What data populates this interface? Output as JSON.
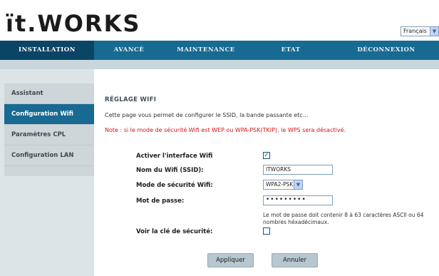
{
  "header": {
    "logo_text": "ït.WORKS",
    "language": {
      "selected": "Français"
    }
  },
  "nav": {
    "items": [
      {
        "label": "INSTALLATION",
        "active": true
      },
      {
        "label": "AVANCÉ",
        "active": false
      },
      {
        "label": "MAINTENANCE",
        "active": false
      },
      {
        "label": "ETAT",
        "active": false
      },
      {
        "label": "DÉCONNEXION",
        "active": false
      }
    ]
  },
  "sidebar": {
    "items": [
      {
        "label": "Assistant",
        "active": false
      },
      {
        "label": "Configuration Wifi",
        "active": true
      },
      {
        "label": "Paramètres CPL",
        "active": false
      },
      {
        "label": "Configuration LAN",
        "active": false
      }
    ]
  },
  "main": {
    "title": "RÉGLAGE WIFI",
    "description": "Cette page vous permet de configurer le SSID, la bande passante etc...",
    "note": "Note : si le mode de sécurité Wifi est WEP ou WPA-PSK(TKIP), le WPS sera désactivé.",
    "form": {
      "enable_label": "Activer l'interface Wifi",
      "enable_checked": true,
      "enable_checkmark": "✓",
      "ssid_label": "Nom du Wifi (SSID):",
      "ssid_value": "ITWORKS",
      "security_label": "Mode de sécurité Wifi:",
      "security_value": "WPA2-PSK",
      "password_label": "Mot de passe:",
      "password_value": "•••••••••",
      "password_hint": "Le mot de passe doit contenir 8 à 63 caractères ASCII ou 64 nombres héxadécimaux.",
      "show_key_label": "Voir la clé de sécurité:",
      "show_key_checked": false
    },
    "buttons": {
      "apply": "Appliquer",
      "cancel": "Annuler"
    }
  },
  "icons": {
    "dropdown": "chevron-down-icon",
    "checkbox": "checkmark-icon"
  },
  "colors": {
    "nav_bg": "#186a92",
    "nav_active": "#0b4566",
    "note_red": "#d61414",
    "sidebar_active": "#186a92"
  }
}
